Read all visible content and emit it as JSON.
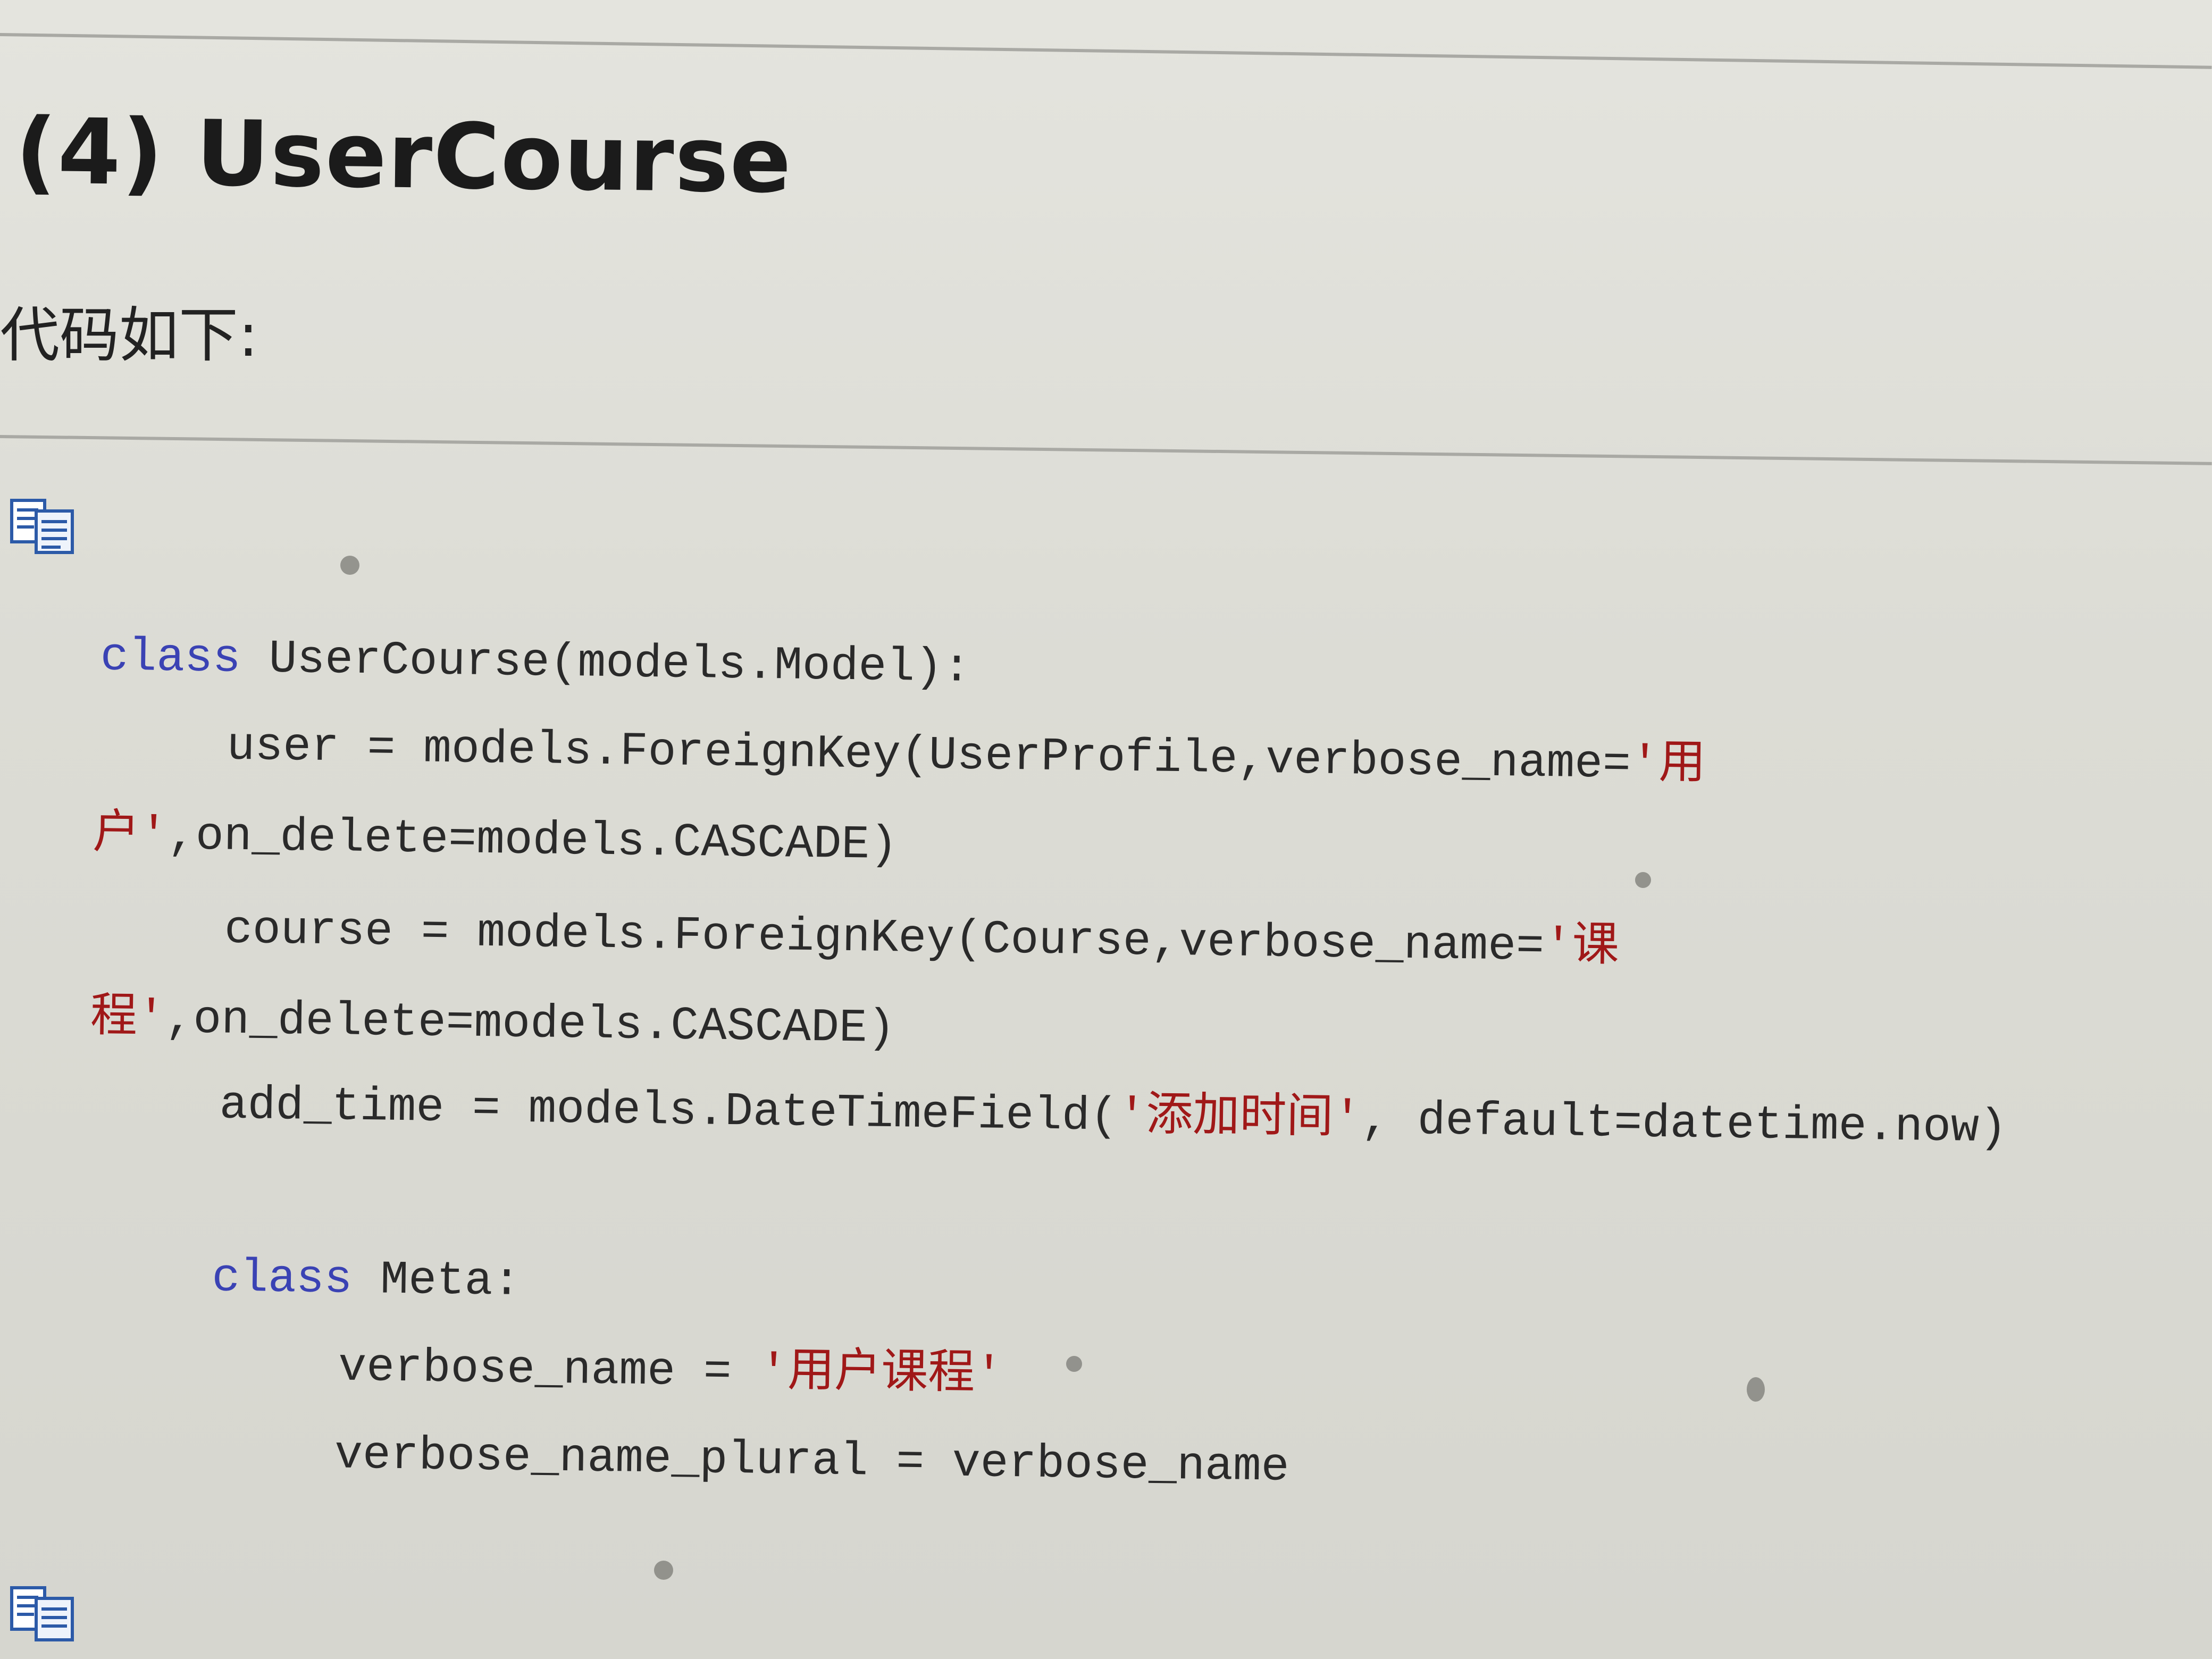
{
  "document": {
    "heading_num": "(4)",
    "heading_title": "UserCourse",
    "intro": "代码如下:"
  },
  "icons": {
    "copy_icon_1": "copy-code-icon",
    "copy_icon_2": "copy-code-icon"
  },
  "code": {
    "line1_kw": "class",
    "line1_rest": " UserCourse(models.Model):",
    "line2_code": "user = models.ForeignKey(UserProfile,verbose_name=",
    "line2_str": "'用",
    "line3_str": "户'",
    "line3_code": ",on_delete=models.CASCADE)",
    "line4_code": "course = models.ForeignKey(Course,verbose_name=",
    "line4_str": "'课",
    "line5_str": "程'",
    "line5_code": ",on_delete=models.CASCADE)",
    "line6_code1": "add_time = models.DateTimeField(",
    "line6_str": "'添加时间'",
    "line6_code2": ", default=datetime.now)",
    "line7_kw": "class",
    "line7_rest": " Meta:",
    "line8_code": "verbose_name = ",
    "line8_str": "'用户课程'",
    "line9_code": "verbose_name_plural = verbose_name"
  },
  "colors": {
    "keyword": "#3a42b4",
    "string": "#a01818",
    "text": "#2a2a2a",
    "background": "#dcdcd6"
  }
}
